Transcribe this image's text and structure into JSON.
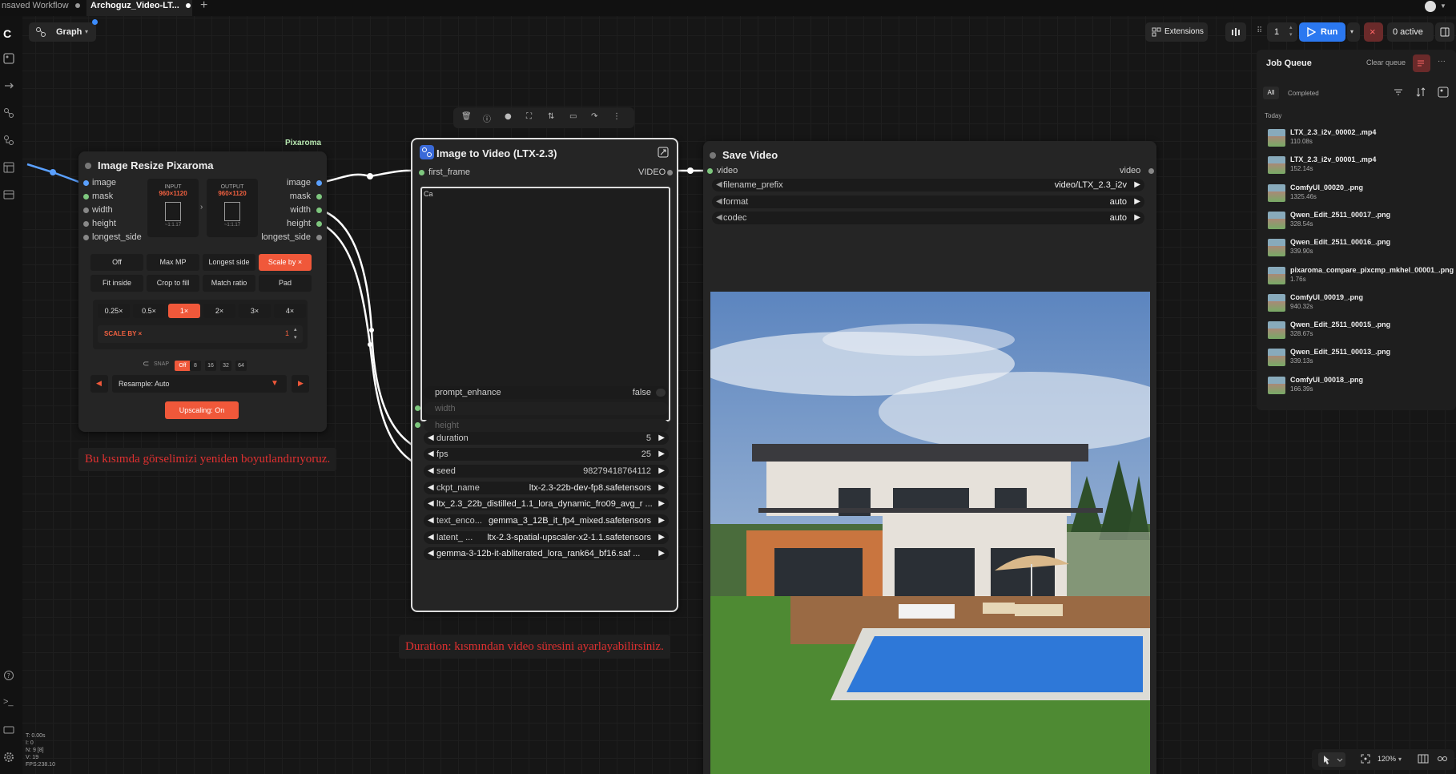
{
  "tabs": [
    {
      "label": "nsaved Workflow"
    },
    {
      "label": "Archoguz_Video-LT..."
    }
  ],
  "toolbar": {
    "graph_label": "Graph",
    "extensions_label": "Extensions",
    "run_count": "1",
    "run_label": "Run",
    "active_label": "0 active"
  },
  "node_toolbar_icons": [
    "trash-icon",
    "info-icon",
    "color-icon",
    "fit-icon",
    "adjust-icon",
    "bookmark-icon",
    "redo-icon",
    "more-icon"
  ],
  "resize_node": {
    "group_label": "Pixaroma",
    "title": "Image Resize Pixaroma",
    "inputs": [
      "image",
      "mask",
      "width",
      "height",
      "longest_side"
    ],
    "outputs": [
      "image",
      "mask",
      "width",
      "height",
      "longest_side"
    ],
    "input_box": {
      "label": "INPUT",
      "size": "960×1120",
      "ratio": "~1:1.17"
    },
    "output_box": {
      "label": "OUTPUT",
      "size": "960×1120",
      "ratio": "~1:1.17"
    },
    "mode_buttons": [
      "Off",
      "Max MP",
      "Longest side",
      "Scale by ×"
    ],
    "mode_active": 3,
    "fit_buttons": [
      "Fit inside",
      "Crop to fill",
      "Match ratio",
      "Pad"
    ],
    "scale_buttons": [
      "0.25×",
      "0.5×",
      "1×",
      "2×",
      "3×",
      "4×"
    ],
    "scale_active": 2,
    "scale_by_label": "SCALE BY ×",
    "scale_by_value": "1",
    "snap_label": "SNAP",
    "snap_options": [
      "Off",
      "8",
      "16",
      "32",
      "64"
    ],
    "resample_label": "Resample: Auto",
    "upscaling_label": "Upscaling: On"
  },
  "notes": {
    "resize": "Bu kısımda görselimizi yeniden boyutlandırıyoruz.",
    "duration": "Duration: kısmından video süresini ayarlayabilirsiniz."
  },
  "i2v_node": {
    "title": "Image to Video (LTX-2.3)",
    "input": "first_frame",
    "output": "VIDEO",
    "prompt_text": "Ca",
    "widgets": [
      {
        "label": "prompt_enhance",
        "value": "false",
        "type": "toggle"
      },
      {
        "label": "width",
        "value": "",
        "type": "input"
      },
      {
        "label": "height",
        "value": "",
        "type": "input"
      },
      {
        "label": "duration",
        "value": "5",
        "type": "number"
      },
      {
        "label": "fps",
        "value": "25",
        "type": "number"
      },
      {
        "label": "seed",
        "value": "98279418764112",
        "type": "number"
      },
      {
        "label": "ckpt_name",
        "value": "ltx-2.3-22b-dev-fp8.safetensors",
        "type": "combo"
      },
      {
        "label": "",
        "value": "ltx_2.3_22b_distilled_1.1_lora_dynamic_fro09_avg_r ...",
        "type": "combo"
      },
      {
        "label": "text_enco...",
        "value": "gemma_3_12B_it_fp4_mixed.safetensors",
        "type": "combo"
      },
      {
        "label": "latent_ ...",
        "value": "ltx-2.3-spatial-upscaler-x2-1.1.safetensors",
        "type": "combo"
      },
      {
        "label": "",
        "value": "gemma-3-12b-it-abliterated_lora_rank64_bf16.saf ...",
        "type": "combo"
      }
    ]
  },
  "save_node": {
    "title": "Save Video",
    "input": "video",
    "output": "video",
    "widgets": [
      {
        "label": "filename_prefix",
        "value": "video/LTX_2.3_i2v"
      },
      {
        "label": "format",
        "value": "auto"
      },
      {
        "label": "codec",
        "value": "auto"
      }
    ]
  },
  "queue": {
    "title": "Job Queue",
    "clear_label": "Clear queue",
    "filters": [
      "All",
      "Completed"
    ],
    "section": "Today",
    "items": [
      {
        "name": "LTX_2.3_i2v_00002_.mp4",
        "time": "110.08s"
      },
      {
        "name": "LTX_2.3_i2v_00001_.mp4",
        "time": "152.14s"
      },
      {
        "name": "ComfyUI_00020_.png",
        "time": "1325.46s"
      },
      {
        "name": "Qwen_Edit_2511_00017_.png",
        "time": "328.54s"
      },
      {
        "name": "Qwen_Edit_2511_00016_.png",
        "time": "339.90s"
      },
      {
        "name": "pixaroma_compare_pixcmp_mkhel_00001_.png",
        "time": "1.76s"
      },
      {
        "name": "ComfyUI_00019_.png",
        "time": "940.32s"
      },
      {
        "name": "Qwen_Edit_2511_00015_.png",
        "time": "328.67s"
      },
      {
        "name": "Qwen_Edit_2511_00013_.png",
        "time": "339.13s"
      },
      {
        "name": "ComfyUI_00018_.png",
        "time": "166.39s"
      }
    ]
  },
  "stats": [
    "T: 0.00s",
    "I: 0",
    "N: 9 [8]",
    "V: 19",
    "FPS:238.10"
  ],
  "zoom": "120%"
}
